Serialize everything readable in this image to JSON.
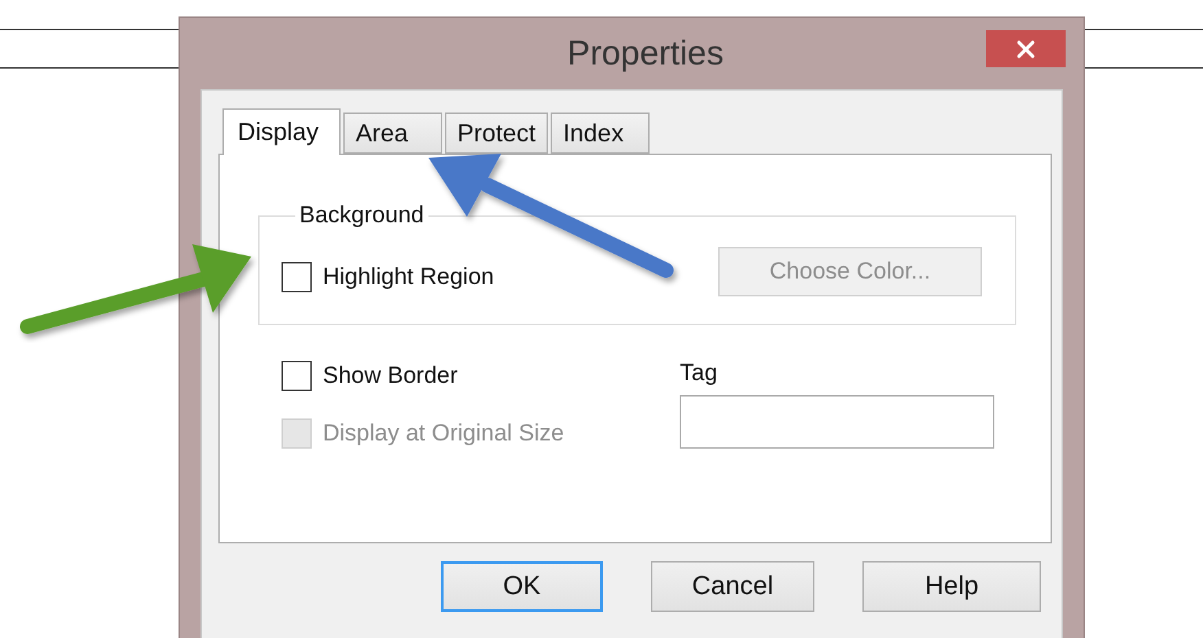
{
  "window": {
    "title": "Properties"
  },
  "tabs": [
    {
      "label": "Display",
      "selected": true
    },
    {
      "label": "Area",
      "selected": false
    },
    {
      "label": "Protect",
      "selected": false
    },
    {
      "label": "Index",
      "selected": false
    }
  ],
  "background_group": {
    "title": "Background",
    "checkbox": {
      "label": "Highlight Region",
      "checked": false,
      "disabled": false
    },
    "button": {
      "label": "Choose Color...",
      "disabled": true
    }
  },
  "options": [
    {
      "label": "Show Border",
      "checked": false,
      "disabled": false
    },
    {
      "label": "Display at Original Size",
      "checked": false,
      "disabled": true
    }
  ],
  "tag": {
    "label": "Tag"
  },
  "buttons": [
    {
      "label": "OK",
      "default": true
    },
    {
      "label": "Cancel",
      "default": false
    },
    {
      "label": "Help",
      "default": false
    }
  ]
}
